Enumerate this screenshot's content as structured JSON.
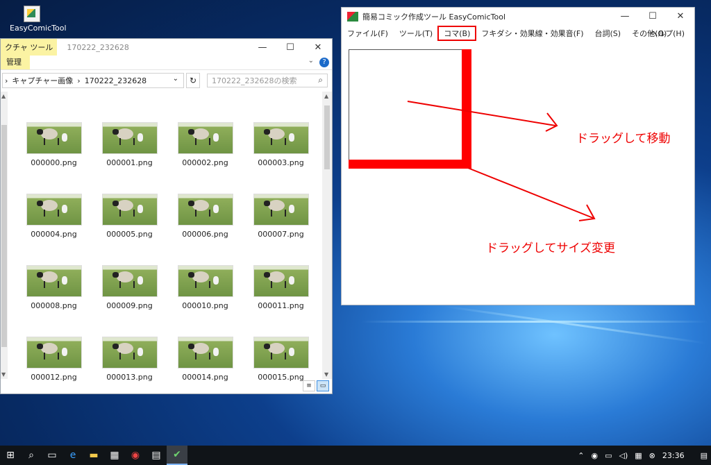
{
  "desktop": {
    "icon_label": "EasyComicTool"
  },
  "explorer": {
    "ribbon_tab": "クチャ ツール",
    "title_path": "170222_232628",
    "manage_label": "管理",
    "breadcrumb": [
      "キャプチャー画像",
      "170222_232628"
    ],
    "search_placeholder": "170222_232628の検索",
    "files": [
      "000000.png",
      "000001.png",
      "000002.png",
      "000003.png",
      "000004.png",
      "000005.png",
      "000006.png",
      "000007.png",
      "000008.png",
      "000009.png",
      "000010.png",
      "000011.png",
      "000012.png",
      "000013.png",
      "000014.png",
      "000015.png"
    ]
  },
  "comic": {
    "title": "簡易コミック作成ツール EasyComicTool",
    "menu": [
      "ファイル(F)",
      "ツール(T)",
      "コマ(B)",
      "フキダシ・効果線・効果音(F)",
      "台詞(S)",
      "その他(O)"
    ],
    "menu_help": "ヘルプ(H)",
    "highlighted_menu_index": 2,
    "note_move": "ドラッグして移動",
    "note_resize": "ドラッグしてサイズ変更",
    "accent_color": "#ee0000"
  },
  "window_buttons": {
    "minimize": "—",
    "maximize": "☐",
    "close": "✕"
  },
  "taskbar": {
    "clock": "23:36"
  }
}
